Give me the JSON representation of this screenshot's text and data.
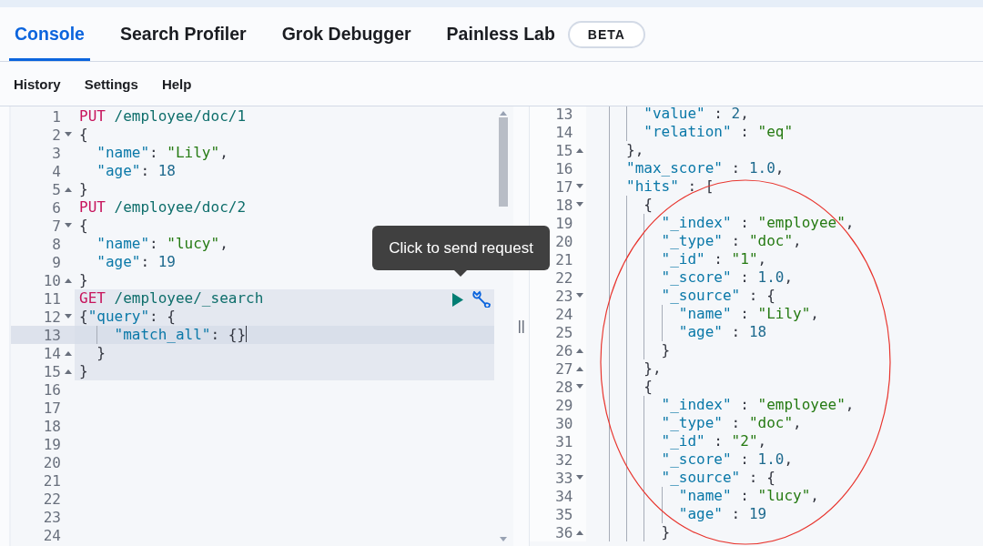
{
  "tabs": [
    {
      "label": "Console",
      "selected": true
    },
    {
      "label": "Search Profiler",
      "selected": false
    },
    {
      "label": "Grok Debugger",
      "selected": false
    },
    {
      "label": "Painless Lab",
      "selected": false,
      "badge": "BETA"
    }
  ],
  "menu": [
    "History",
    "Settings",
    "Help"
  ],
  "request_editor": {
    "lines": [
      {
        "number": "1",
        "kind": "plain",
        "highlighted": false,
        "active": false,
        "tokens": [
          {
            "kind": "method",
            "text": "PUT"
          },
          {
            "kind": "path",
            "text": " /employee/doc/1"
          }
        ]
      },
      {
        "number": "2",
        "kind": "open",
        "highlighted": false,
        "active": false,
        "tokens": [
          {
            "kind": "punct",
            "text": "{"
          }
        ]
      },
      {
        "number": "3",
        "kind": "plain",
        "highlighted": false,
        "active": false,
        "tokens": [
          {
            "kind": "key",
            "text": "  \"name\""
          },
          {
            "kind": "punct",
            "text": ": "
          },
          {
            "kind": "string",
            "text": "\"Lily\""
          },
          {
            "kind": "punct",
            "text": ","
          }
        ]
      },
      {
        "number": "4",
        "kind": "plain",
        "highlighted": false,
        "active": false,
        "tokens": [
          {
            "kind": "key",
            "text": "  \"age\""
          },
          {
            "kind": "punct",
            "text": ": "
          },
          {
            "kind": "number",
            "text": "18"
          }
        ]
      },
      {
        "number": "5",
        "kind": "close",
        "highlighted": false,
        "active": false,
        "tokens": [
          {
            "kind": "punct",
            "text": "}"
          }
        ]
      },
      {
        "number": "6",
        "kind": "plain",
        "highlighted": false,
        "active": false,
        "tokens": [
          {
            "kind": "method",
            "text": "PUT"
          },
          {
            "kind": "path",
            "text": " /employee/doc/2"
          }
        ]
      },
      {
        "number": "7",
        "kind": "open",
        "highlighted": false,
        "active": false,
        "tokens": [
          {
            "kind": "punct",
            "text": "{"
          }
        ]
      },
      {
        "number": "8",
        "kind": "plain",
        "highlighted": false,
        "active": false,
        "tokens": [
          {
            "kind": "key",
            "text": "  \"name\""
          },
          {
            "kind": "punct",
            "text": ": "
          },
          {
            "kind": "string",
            "text": "\"lucy\""
          },
          {
            "kind": "punct",
            "text": ","
          }
        ]
      },
      {
        "number": "9",
        "kind": "plain",
        "highlighted": false,
        "active": false,
        "tokens": [
          {
            "kind": "key",
            "text": "  \"age\""
          },
          {
            "kind": "punct",
            "text": ": "
          },
          {
            "kind": "number",
            "text": "19"
          }
        ]
      },
      {
        "number": "10",
        "kind": "close",
        "highlighted": false,
        "active": false,
        "tokens": [
          {
            "kind": "punct",
            "text": "}"
          }
        ]
      },
      {
        "number": "11",
        "kind": "plain",
        "highlighted": true,
        "active": false,
        "tokens": [
          {
            "kind": "method",
            "text": "GET"
          },
          {
            "kind": "path",
            "text": " /employee/_search"
          }
        ]
      },
      {
        "number": "12",
        "kind": "open",
        "highlighted": true,
        "active": false,
        "tokens": [
          {
            "kind": "punct",
            "text": "{"
          },
          {
            "kind": "key",
            "text": "\"query\""
          },
          {
            "kind": "punct",
            "text": ": {"
          }
        ]
      },
      {
        "number": "13",
        "kind": "plain",
        "highlighted": true,
        "active": true,
        "tokens": [
          {
            "kind": "key",
            "text": "    \"match_all\""
          },
          {
            "kind": "punct",
            "text": ": {}"
          }
        ]
      },
      {
        "number": "14",
        "kind": "close",
        "highlighted": true,
        "active": false,
        "tokens": [
          {
            "kind": "punct",
            "text": "  }"
          }
        ]
      },
      {
        "number": "15",
        "kind": "close",
        "highlighted": true,
        "active": false,
        "tokens": [
          {
            "kind": "punct",
            "text": "}"
          }
        ]
      },
      {
        "number": "16",
        "kind": "plain",
        "highlighted": false,
        "active": false
      },
      {
        "number": "17",
        "kind": "plain",
        "highlighted": false,
        "active": false
      },
      {
        "number": "18",
        "kind": "plain",
        "highlighted": false,
        "active": false
      },
      {
        "number": "19",
        "kind": "plain",
        "highlighted": false,
        "active": false
      },
      {
        "number": "20",
        "kind": "plain",
        "highlighted": false,
        "active": false
      },
      {
        "number": "21",
        "kind": "plain",
        "highlighted": false,
        "active": false
      },
      {
        "number": "22",
        "kind": "plain",
        "highlighted": false,
        "active": false
      },
      {
        "number": "23",
        "kind": "plain",
        "highlighted": false,
        "active": false
      },
      {
        "number": "24",
        "kind": "plain",
        "highlighted": false,
        "active": false
      }
    ]
  },
  "tooltip": "Click to send request",
  "response_viewer": {
    "lines": [
      {
        "number": "13",
        "kind": "plain",
        "tokens": [
          {
            "kind": "key",
            "text": "      \"value\""
          },
          {
            "kind": "punct",
            "text": " : "
          },
          {
            "kind": "number",
            "text": "2"
          },
          {
            "kind": "punct",
            "text": ","
          }
        ]
      },
      {
        "number": "14",
        "kind": "plain",
        "tokens": [
          {
            "kind": "key",
            "text": "      \"relation\""
          },
          {
            "kind": "punct",
            "text": " : "
          },
          {
            "kind": "string",
            "text": "\"eq\""
          }
        ]
      },
      {
        "number": "15",
        "kind": "close",
        "tokens": [
          {
            "kind": "punct",
            "text": "    },"
          }
        ]
      },
      {
        "number": "16",
        "kind": "plain",
        "tokens": [
          {
            "kind": "key",
            "text": "    \"max_score\""
          },
          {
            "kind": "punct",
            "text": " : "
          },
          {
            "kind": "number",
            "text": "1.0"
          },
          {
            "kind": "punct",
            "text": ","
          }
        ]
      },
      {
        "number": "17",
        "kind": "open",
        "tokens": [
          {
            "kind": "key",
            "text": "    \"hits\""
          },
          {
            "kind": "punct",
            "text": " : ["
          }
        ]
      },
      {
        "number": "18",
        "kind": "open",
        "tokens": [
          {
            "kind": "punct",
            "text": "      {"
          }
        ]
      },
      {
        "number": "19",
        "kind": "plain",
        "tokens": [
          {
            "kind": "key",
            "text": "        \"_index\""
          },
          {
            "kind": "punct",
            "text": " : "
          },
          {
            "kind": "string",
            "text": "\"employee\""
          },
          {
            "kind": "punct",
            "text": ","
          }
        ]
      },
      {
        "number": "20",
        "kind": "plain",
        "tokens": [
          {
            "kind": "key",
            "text": "        \"_type\""
          },
          {
            "kind": "punct",
            "text": " : "
          },
          {
            "kind": "string",
            "text": "\"doc\""
          },
          {
            "kind": "punct",
            "text": ","
          }
        ]
      },
      {
        "number": "21",
        "kind": "plain",
        "tokens": [
          {
            "kind": "key",
            "text": "        \"_id\""
          },
          {
            "kind": "punct",
            "text": " : "
          },
          {
            "kind": "string",
            "text": "\"1\""
          },
          {
            "kind": "punct",
            "text": ","
          }
        ]
      },
      {
        "number": "22",
        "kind": "plain",
        "tokens": [
          {
            "kind": "key",
            "text": "        \"_score\""
          },
          {
            "kind": "punct",
            "text": " : "
          },
          {
            "kind": "number",
            "text": "1.0"
          },
          {
            "kind": "punct",
            "text": ","
          }
        ]
      },
      {
        "number": "23",
        "kind": "open",
        "tokens": [
          {
            "kind": "key",
            "text": "        \"_source\""
          },
          {
            "kind": "punct",
            "text": " : {"
          }
        ]
      },
      {
        "number": "24",
        "kind": "plain",
        "tokens": [
          {
            "kind": "key",
            "text": "          \"name\""
          },
          {
            "kind": "punct",
            "text": " : "
          },
          {
            "kind": "string",
            "text": "\"Lily\""
          },
          {
            "kind": "punct",
            "text": ","
          }
        ]
      },
      {
        "number": "25",
        "kind": "plain",
        "tokens": [
          {
            "kind": "key",
            "text": "          \"age\""
          },
          {
            "kind": "punct",
            "text": " : "
          },
          {
            "kind": "number",
            "text": "18"
          }
        ]
      },
      {
        "number": "26",
        "kind": "close",
        "tokens": [
          {
            "kind": "punct",
            "text": "        }"
          }
        ]
      },
      {
        "number": "27",
        "kind": "close",
        "tokens": [
          {
            "kind": "punct",
            "text": "      },"
          }
        ]
      },
      {
        "number": "28",
        "kind": "open",
        "tokens": [
          {
            "kind": "punct",
            "text": "      {"
          }
        ]
      },
      {
        "number": "29",
        "kind": "plain",
        "tokens": [
          {
            "kind": "key",
            "text": "        \"_index\""
          },
          {
            "kind": "punct",
            "text": " : "
          },
          {
            "kind": "string",
            "text": "\"employee\""
          },
          {
            "kind": "punct",
            "text": ","
          }
        ]
      },
      {
        "number": "30",
        "kind": "plain",
        "tokens": [
          {
            "kind": "key",
            "text": "        \"_type\""
          },
          {
            "kind": "punct",
            "text": " : "
          },
          {
            "kind": "string",
            "text": "\"doc\""
          },
          {
            "kind": "punct",
            "text": ","
          }
        ]
      },
      {
        "number": "31",
        "kind": "plain",
        "tokens": [
          {
            "kind": "key",
            "text": "        \"_id\""
          },
          {
            "kind": "punct",
            "text": " : "
          },
          {
            "kind": "string",
            "text": "\"2\""
          },
          {
            "kind": "punct",
            "text": ","
          }
        ]
      },
      {
        "number": "32",
        "kind": "plain",
        "tokens": [
          {
            "kind": "key",
            "text": "        \"_score\""
          },
          {
            "kind": "punct",
            "text": " : "
          },
          {
            "kind": "number",
            "text": "1.0"
          },
          {
            "kind": "punct",
            "text": ","
          }
        ]
      },
      {
        "number": "33",
        "kind": "open",
        "tokens": [
          {
            "kind": "key",
            "text": "        \"_source\""
          },
          {
            "kind": "punct",
            "text": " : {"
          }
        ]
      },
      {
        "number": "34",
        "kind": "plain",
        "tokens": [
          {
            "kind": "key",
            "text": "          \"name\""
          },
          {
            "kind": "punct",
            "text": " : "
          },
          {
            "kind": "string",
            "text": "\"lucy\""
          },
          {
            "kind": "punct",
            "text": ","
          }
        ]
      },
      {
        "number": "35",
        "kind": "plain",
        "tokens": [
          {
            "kind": "key",
            "text": "          \"age\""
          },
          {
            "kind": "punct",
            "text": " : "
          },
          {
            "kind": "number",
            "text": "19"
          }
        ]
      },
      {
        "number": "36",
        "kind": "close",
        "tokens": [
          {
            "kind": "punct",
            "text": "        }"
          }
        ]
      }
    ]
  },
  "annotations": [
    {
      "kind": "ellipse"
    }
  ]
}
